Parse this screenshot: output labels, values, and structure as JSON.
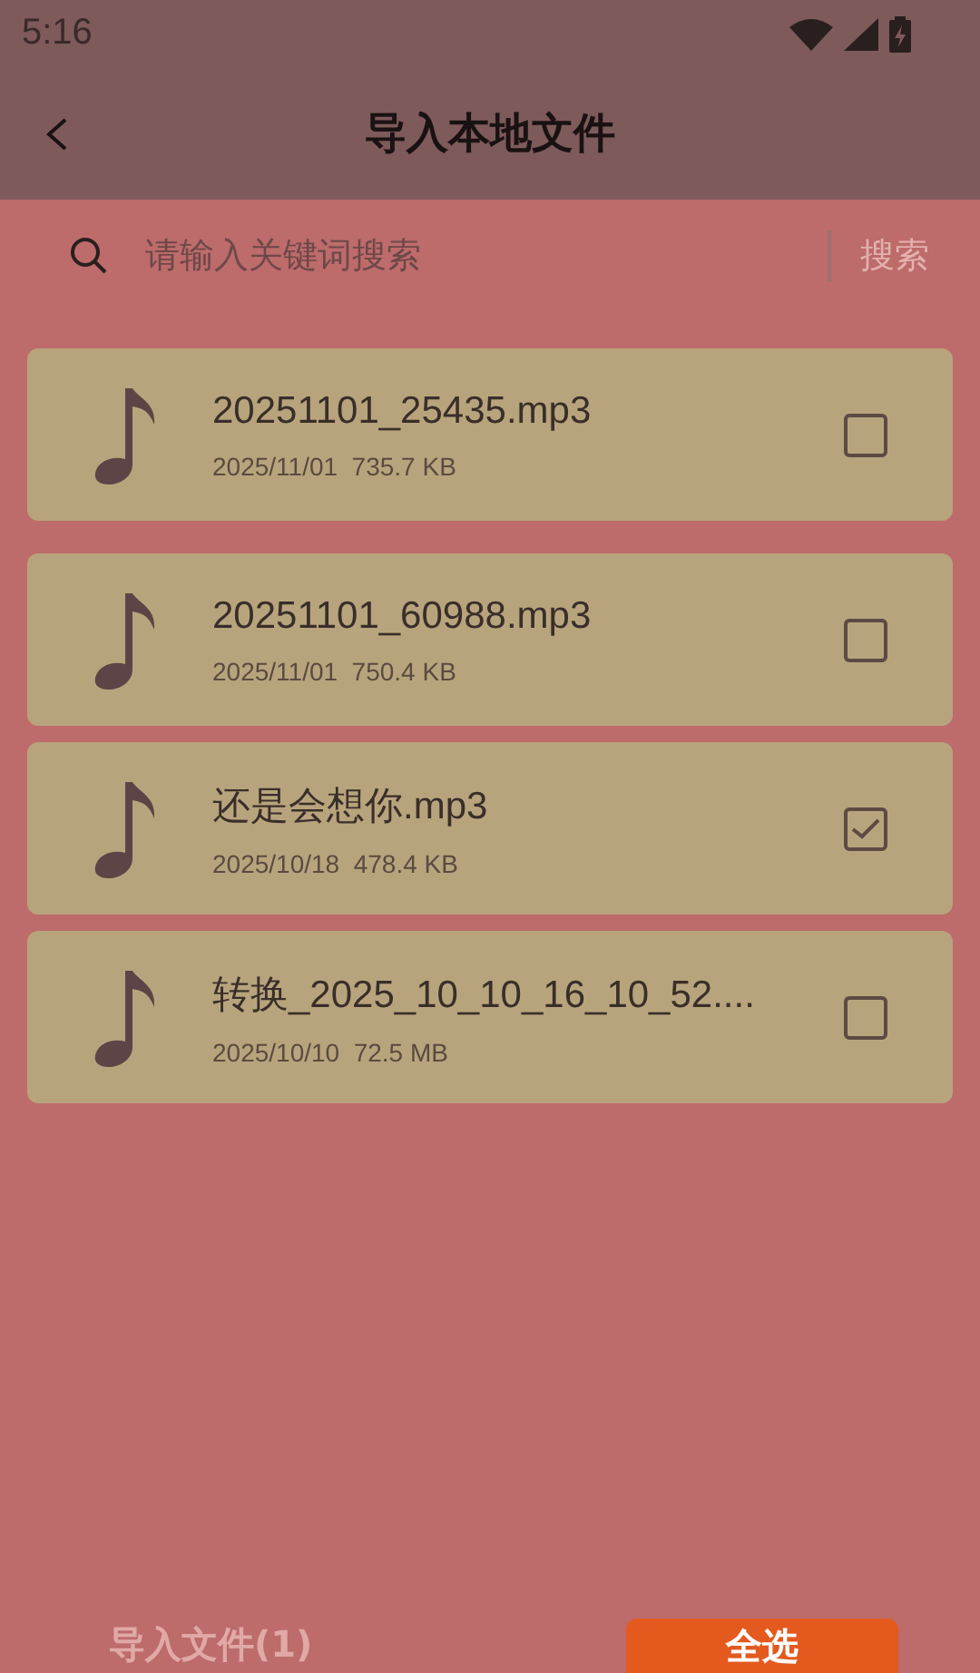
{
  "status_bar": {
    "time": "5:16"
  },
  "header": {
    "title": "导入本地文件"
  },
  "search": {
    "placeholder": "请输入关键词搜索",
    "button": "搜索"
  },
  "files": [
    {
      "name": "20251101_25435.mp3",
      "date": "2025/11/01",
      "size": "735.7 KB",
      "checked": false
    },
    {
      "name": "20251101_60988.mp3",
      "date": "2025/11/01",
      "size": "750.4 KB",
      "checked": false
    },
    {
      "name": "还是会想你.mp3",
      "date": "2025/10/18",
      "size": "478.4 KB",
      "checked": true
    },
    {
      "name": "转换_2025_10_10_16_10_52....",
      "date": "2025/10/10",
      "size": "72.5 MB",
      "checked": false
    }
  ],
  "footer": {
    "import_button": "导入文件(1)",
    "select_all_button": "全选"
  }
}
